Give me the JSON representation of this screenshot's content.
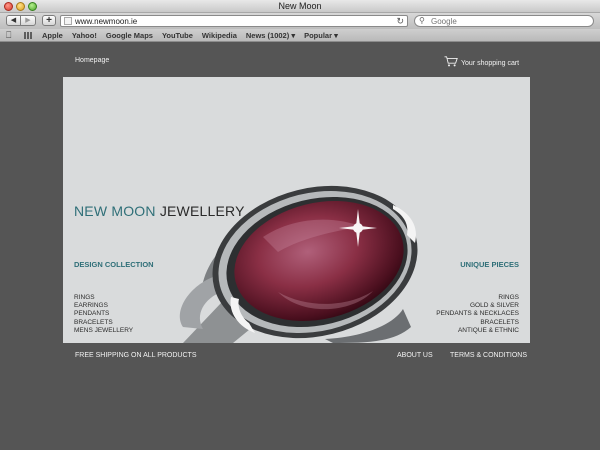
{
  "window": {
    "title": "New Moon"
  },
  "toolbar": {
    "back_icon": "back-arrow-icon",
    "forward_icon": "forward-arrow-icon",
    "add_icon": "plus-icon",
    "url": "www.newmoon.ie",
    "search_placeholder": "Google"
  },
  "bookmarks": {
    "items": [
      "Apple",
      "Yahoo!",
      "Google Maps",
      "YouTube",
      "Wikipedia",
      "News (1002) ▾",
      "Popular ▾"
    ]
  },
  "page": {
    "homepage_link": "Homepage",
    "cart_label": "Your shopping cart",
    "brand_part1": "NEW MOON",
    "brand_part2": "JEWELLERY",
    "left_title": "DESIGN COLLECTION",
    "right_title": "UNIQUE PIECES",
    "left_items": [
      "RINGS",
      "EARRINGS",
      "PENDANTS",
      "BRACELETS",
      "MENS JEWELLERY"
    ],
    "right_items": [
      "RINGS",
      "GOLD & SILVER",
      "PENDANTS & NECKLACES",
      "BRACELETS",
      "ANTIQUE & ETHNIC"
    ],
    "footer_shipping": "FREE SHIPPING ON ALL PRODUCTS",
    "footer_about": "ABOUT US",
    "footer_terms": "TERMS & CONDITIONS"
  },
  "colors": {
    "page_bg": "#555555",
    "hero_bg": "#d9dbdc",
    "accent_teal": "#2f6f78",
    "gem": "#8a2f45"
  }
}
